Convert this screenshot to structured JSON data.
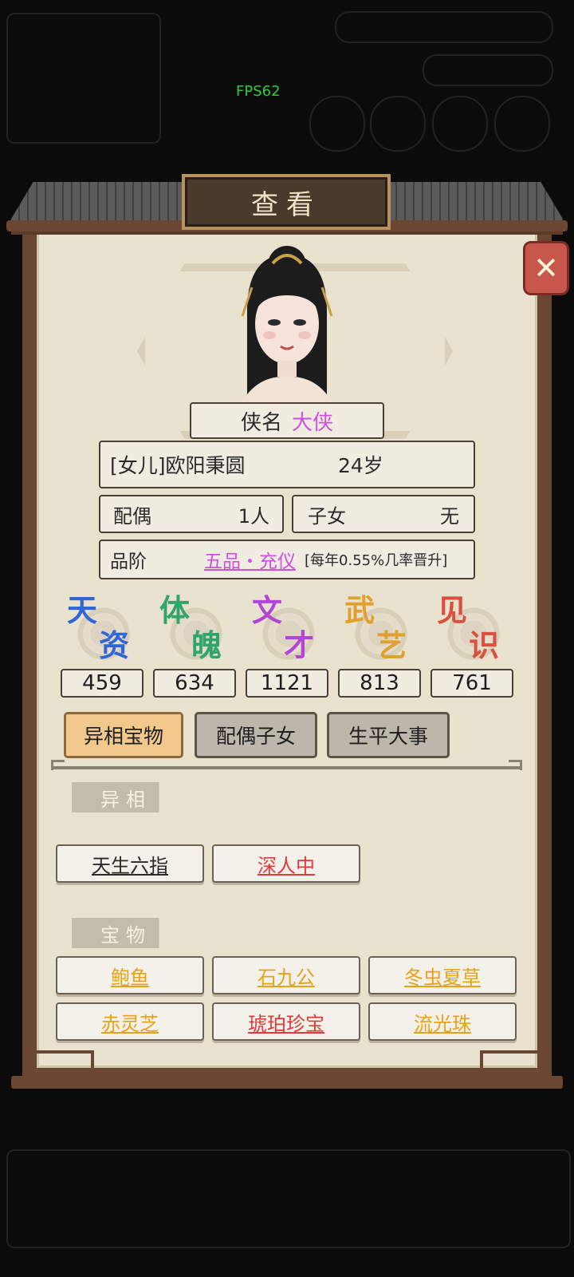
{
  "fps": "FPS62",
  "dialog_title": "查看",
  "close_icon": "close-icon",
  "profile": {
    "name_label": "侠名",
    "name_value": "大侠",
    "identity": "[女儿]欧阳秉圆",
    "age": "24岁",
    "spouse_label": "配偶",
    "spouse_value": "1人",
    "children_label": "子女",
    "children_value": "无",
    "rank_label": "品阶",
    "rank_value": "五品・充仪",
    "rank_note": "[每年0.55%几率晋升]"
  },
  "stats": [
    {
      "char1": "天",
      "char2": "资",
      "value": "459",
      "color": "#2f66d8"
    },
    {
      "char1": "体",
      "char2": "魄",
      "value": "634",
      "color": "#2fa56a"
    },
    {
      "char1": "文",
      "char2": "才",
      "value": "1121",
      "color": "#b244d6"
    },
    {
      "char1": "武",
      "char2": "艺",
      "value": "813",
      "color": "#e0a030"
    },
    {
      "char1": "见",
      "char2": "识",
      "value": "761",
      "color": "#d9503f"
    }
  ],
  "tabs": [
    {
      "label": "异相宝物",
      "active": true
    },
    {
      "label": "配偶子女",
      "active": false
    },
    {
      "label": "生平大事",
      "active": false
    }
  ],
  "traits_header": "异相",
  "traits": [
    {
      "label": "天生六指",
      "color": "#2a2a2a"
    },
    {
      "label": "深人中",
      "color": "#e03a3a"
    }
  ],
  "treasures_header": "宝物",
  "treasures": [
    {
      "label": "鲍鱼",
      "color": "#e8a21a"
    },
    {
      "label": "石九公",
      "color": "#e8a21a"
    },
    {
      "label": "冬虫夏草",
      "color": "#e8a21a"
    },
    {
      "label": "赤灵芝",
      "color": "#e8a21a"
    },
    {
      "label": "琥珀珍宝",
      "color": "#e03a3a"
    },
    {
      "label": "流光珠",
      "color": "#e8a21a"
    }
  ]
}
